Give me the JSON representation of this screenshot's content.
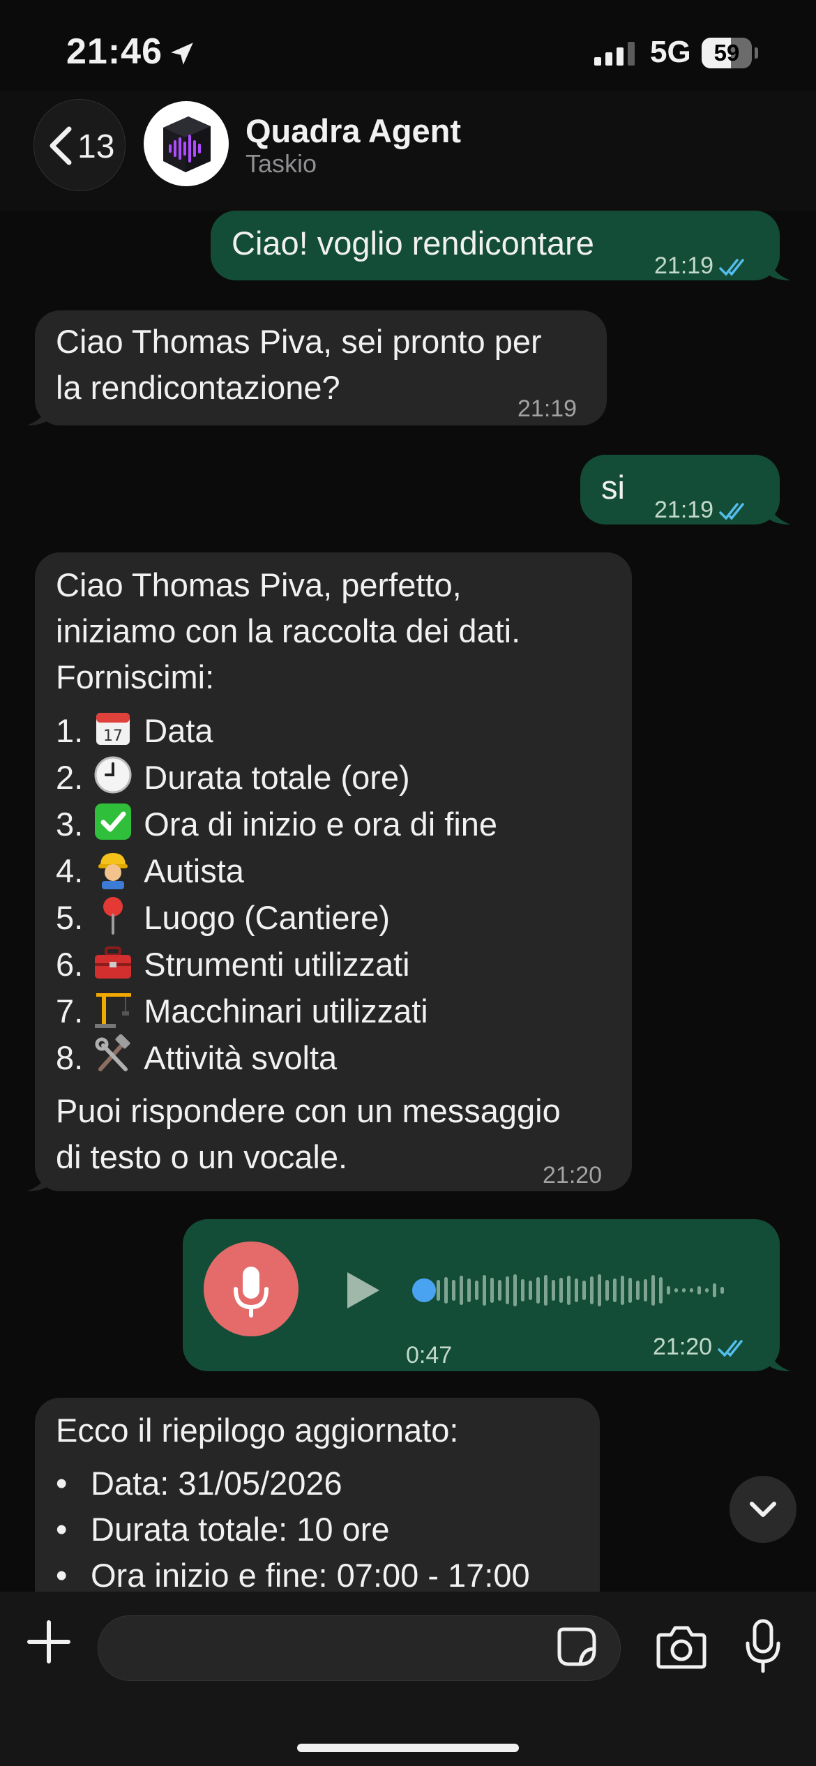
{
  "status": {
    "time": "21:46",
    "network": "5G",
    "battery": "59",
    "battery_level": 0.59
  },
  "header": {
    "back_count": "13",
    "name": "Quadra Agent",
    "subtitle": "Taskio"
  },
  "messages": [
    {
      "dir": "out",
      "text": "Ciao! voglio rendicontare",
      "time": "21:19"
    },
    {
      "dir": "in",
      "lines": [
        "Ciao Thomas Piva, sei pronto per",
        "la rendicontazione?"
      ],
      "time": "21:19"
    },
    {
      "dir": "out",
      "text": "si",
      "time": "21:19"
    },
    {
      "dir": "in",
      "intro": [
        "Ciao Thomas Piva, perfetto,",
        "iniziamo con la raccolta dei dati.",
        "Forniscimi:"
      ],
      "items": [
        {
          "num": "1.",
          "icon": "calendar-icon",
          "text": "Data"
        },
        {
          "num": "2.",
          "icon": "clock-icon",
          "text": "Durata totale (ore)"
        },
        {
          "num": "3.",
          "icon": "check-mark-icon",
          "text": "Ora di inizio e ora di fine"
        },
        {
          "num": "4.",
          "icon": "construction-worker-icon",
          "text": "Autista"
        },
        {
          "num": "5.",
          "icon": "pushpin-icon",
          "text": "Luogo (Cantiere)"
        },
        {
          "num": "6.",
          "icon": "toolbox-icon",
          "text": "Strumenti utilizzati"
        },
        {
          "num": "7.",
          "icon": "crane-icon",
          "text": "Macchinari utilizzati"
        },
        {
          "num": "8.",
          "icon": "hammer-wrench-icon",
          "text": "Attività svolta"
        }
      ],
      "outro": [
        "Puoi rispondere con un messaggio",
        "di testo o un vocale."
      ],
      "time": "21:20"
    },
    {
      "dir": "out",
      "type": "voice",
      "duration": "0:47",
      "time": "21:20"
    },
    {
      "dir": "in",
      "intro": [
        "Ecco il riepilogo aggiornato:"
      ],
      "bullets": [
        "Data: 31/05/2026",
        "Durata totale: 10 ore",
        "Ora inizio e fine: 07:00 - 17:00"
      ]
    }
  ],
  "composer": {
    "placeholder": ""
  },
  "colors": {
    "outgoing": "#144d37",
    "incoming": "#262626",
    "ticks": "#53bdeb",
    "voice_mic": "#e56b6b",
    "voice_dot": "#4aa3f0"
  }
}
